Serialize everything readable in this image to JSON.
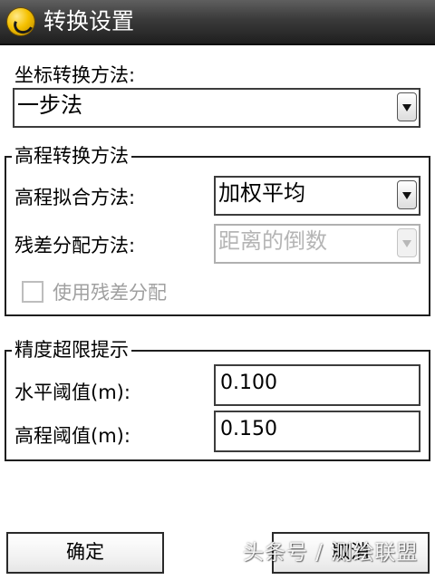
{
  "window": {
    "title": "转换设置"
  },
  "coordinate": {
    "label": "坐标转换方法:",
    "method": "一步法"
  },
  "elevation_group": {
    "title": "高程转换方法",
    "fit_label": "高程拟合方法:",
    "fit_value": "加权平均",
    "residual_label": "残差分配方法:",
    "residual_value": "距离的倒数",
    "use_residual_label": "使用残差分配",
    "use_residual_checked": false
  },
  "precision_group": {
    "title": "精度超限提示",
    "horizontal_label": "水平阈值(m):",
    "horizontal_value": "0.100",
    "elevation_label": "高程阈值(m):",
    "elevation_value": "0.150"
  },
  "buttons": {
    "ok_label": "确定",
    "cancel_label": "取消"
  },
  "watermark": "头条号 / 测绘联盟",
  "icons": {
    "app": "app-logo-icon",
    "dropdown": "dropdown-arrow-icon"
  },
  "colors": {
    "titlebar": "#2e2e2e",
    "disabled_text": "#a0a0a0",
    "app_icon": "#f5c100"
  }
}
